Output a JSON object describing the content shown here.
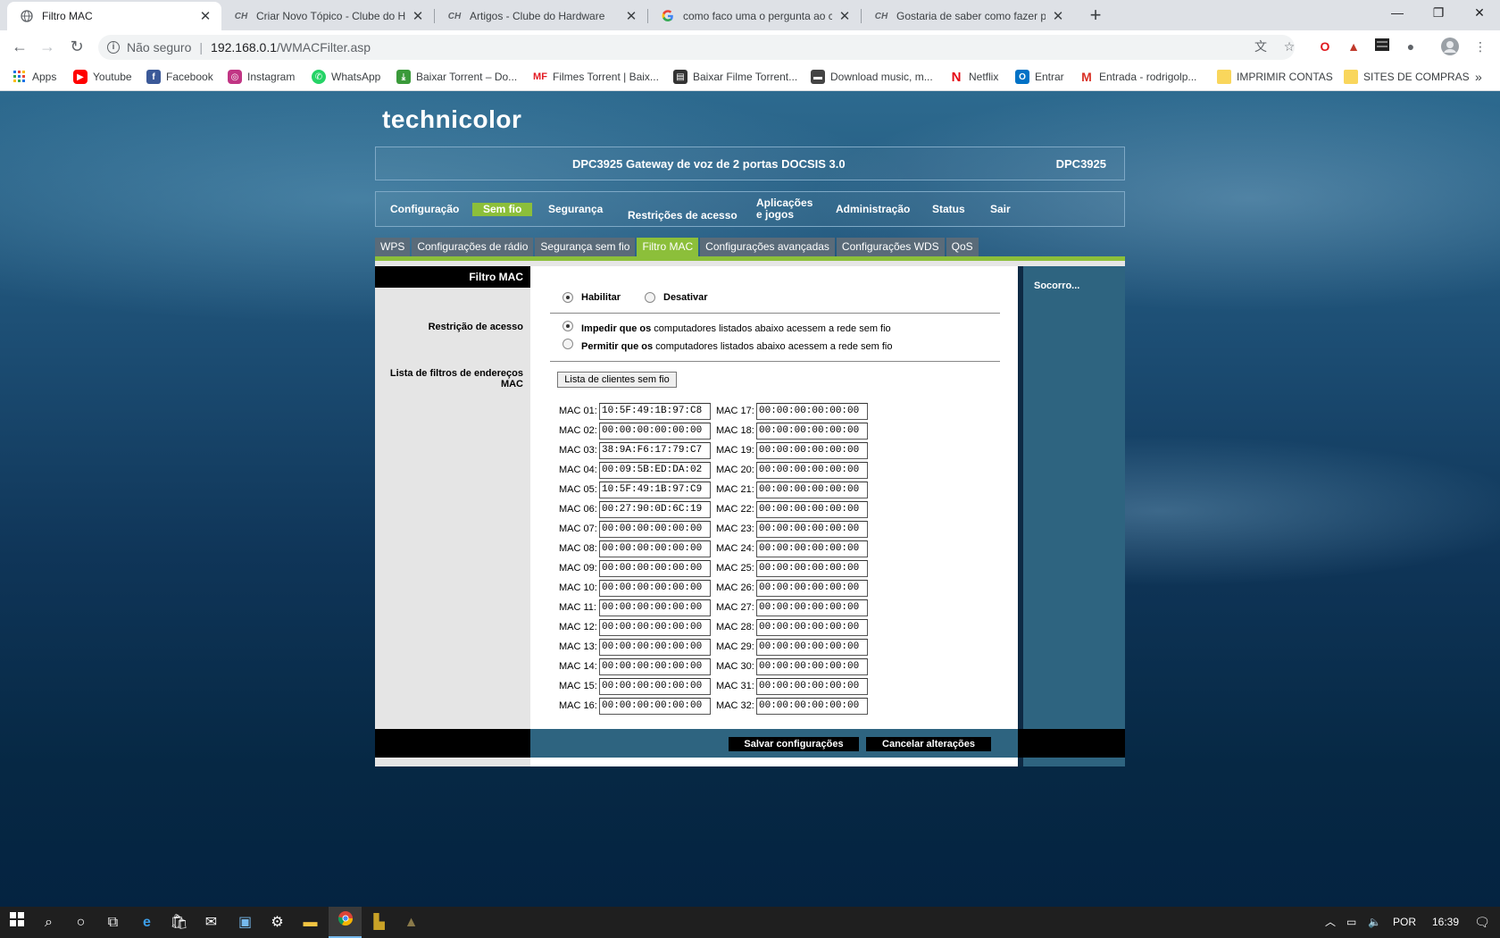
{
  "browser": {
    "tabs": [
      {
        "title": "Filtro MAC",
        "active": true
      },
      {
        "title": "Criar Novo Tópico - Clube do Hardware",
        "active": false
      },
      {
        "title": "Artigos - Clube do Hardware",
        "active": false
      },
      {
        "title": "como faco uma o pergunta ao clube",
        "active": false
      },
      {
        "title": "Gostaria de saber como fazer pedido",
        "active": false
      }
    ],
    "tab_close": "✕",
    "new_tab": "+",
    "window_controls": {
      "minimize": "—",
      "restore": "❐",
      "close": "✕"
    },
    "address": {
      "security": "Não seguro",
      "separator": "|",
      "host": "192.168.0.1",
      "path": "/WMACFilter.asp"
    },
    "bookmarks": [
      {
        "label": "Apps",
        "icon": "apps-grid-icon"
      },
      {
        "label": "Youtube",
        "icon": "youtube-icon"
      },
      {
        "label": "Facebook",
        "icon": "facebook-icon"
      },
      {
        "label": "Instagram",
        "icon": "instagram-icon"
      },
      {
        "label": "WhatsApp",
        "icon": "whatsapp-icon"
      },
      {
        "label": "Baixar Torrent – Do...",
        "icon": "torrent-icon"
      },
      {
        "label": "Filmes Torrent | Baix...",
        "icon": "mf-icon"
      },
      {
        "label": "Baixar Filme Torrent...",
        "icon": "film-icon"
      },
      {
        "label": "Download music, m...",
        "icon": "car-icon"
      },
      {
        "label": "Netflix",
        "icon": "netflix-icon"
      },
      {
        "label": "Entrar",
        "icon": "outlook-icon"
      },
      {
        "label": "Entrada - rodrigolp...",
        "icon": "gmail-icon"
      },
      {
        "label": "IMPRIMIR CONTAS",
        "icon": "folder-icon"
      },
      {
        "label": "SITES DE COMPRAS",
        "icon": "folder-icon"
      }
    ],
    "bookmarks_more": "»"
  },
  "router": {
    "logo": "technicolor",
    "product": "DPC3925 Gateway de voz de 2 portas DOCSIS 3.0",
    "model": "DPC3925",
    "main_nav": {
      "configuracao": "Configuração",
      "sem_fio": "Sem fio",
      "seguranca": "Segurança",
      "restricoes": "Restrições de acesso",
      "aplicacoes_1": "Aplicações",
      "aplicacoes_2": "e jogos",
      "administracao": "Administração",
      "status": "Status",
      "sair": "Sair"
    },
    "sub_nav": [
      "WPS",
      "Configurações de rádio",
      "Segurança sem fio",
      "Filtro MAC",
      "Configurações avançadas",
      "Configurações WDS",
      "QoS"
    ],
    "section_title": "Filtro MAC",
    "labels": {
      "restricao": "Restrição de acesso",
      "lista_1": "Lista de filtros de endereços",
      "lista_2": "MAC"
    },
    "help": "Socorro...",
    "enable": {
      "habilitar": "Habilitar",
      "desativar": "Desativar",
      "selected": "habilitar"
    },
    "restriction": {
      "impedir_bold": "Impedir que os",
      "impedir_rest": " computadores listados abaixo acessem a rede sem fio",
      "permitir_bold": "Permitir que os",
      "permitir_rest": " computadores listados abaixo acessem a rede sem fio",
      "selected": "impedir"
    },
    "wireless_list_button": "Lista de clientes sem fio",
    "mac_left": [
      {
        "label": "MAC 01:",
        "value": "10:5F:49:1B:97:C8"
      },
      {
        "label": "MAC 02:",
        "value": "00:00:00:00:00:00"
      },
      {
        "label": "MAC 03:",
        "value": "38:9A:F6:17:79:C7"
      },
      {
        "label": "MAC 04:",
        "value": "00:09:5B:ED:DA:02"
      },
      {
        "label": "MAC 05:",
        "value": "10:5F:49:1B:97:C9"
      },
      {
        "label": "MAC 06:",
        "value": "00:27:90:0D:6C:19"
      },
      {
        "label": "MAC 07:",
        "value": "00:00:00:00:00:00"
      },
      {
        "label": "MAC 08:",
        "value": "00:00:00:00:00:00"
      },
      {
        "label": "MAC 09:",
        "value": "00:00:00:00:00:00"
      },
      {
        "label": "MAC 10:",
        "value": "00:00:00:00:00:00"
      },
      {
        "label": "MAC 11:",
        "value": "00:00:00:00:00:00"
      },
      {
        "label": "MAC 12:",
        "value": "00:00:00:00:00:00"
      },
      {
        "label": "MAC 13:",
        "value": "00:00:00:00:00:00"
      },
      {
        "label": "MAC 14:",
        "value": "00:00:00:00:00:00"
      },
      {
        "label": "MAC 15:",
        "value": "00:00:00:00:00:00"
      },
      {
        "label": "MAC 16:",
        "value": "00:00:00:00:00:00"
      }
    ],
    "mac_right": [
      {
        "label": "MAC 17:",
        "value": "00:00:00:00:00:00"
      },
      {
        "label": "MAC 18:",
        "value": "00:00:00:00:00:00"
      },
      {
        "label": "MAC 19:",
        "value": "00:00:00:00:00:00"
      },
      {
        "label": "MAC 20:",
        "value": "00:00:00:00:00:00"
      },
      {
        "label": "MAC 21:",
        "value": "00:00:00:00:00:00"
      },
      {
        "label": "MAC 22:",
        "value": "00:00:00:00:00:00"
      },
      {
        "label": "MAC 23:",
        "value": "00:00:00:00:00:00"
      },
      {
        "label": "MAC 24:",
        "value": "00:00:00:00:00:00"
      },
      {
        "label": "MAC 25:",
        "value": "00:00:00:00:00:00"
      },
      {
        "label": "MAC 26:",
        "value": "00:00:00:00:00:00"
      },
      {
        "label": "MAC 27:",
        "value": "00:00:00:00:00:00"
      },
      {
        "label": "MAC 28:",
        "value": "00:00:00:00:00:00"
      },
      {
        "label": "MAC 29:",
        "value": "00:00:00:00:00:00"
      },
      {
        "label": "MAC 30:",
        "value": "00:00:00:00:00:00"
      },
      {
        "label": "MAC 31:",
        "value": "00:00:00:00:00:00"
      },
      {
        "label": "MAC 32:",
        "value": "00:00:00:00:00:00"
      }
    ],
    "save": "Salvar configurações",
    "cancel": "Cancelar alterações"
  },
  "taskbar": {
    "language": "POR",
    "time": "16:39"
  },
  "colors": {
    "accent_green": "#8cbf3a",
    "subtab_gray": "#5a6b79",
    "help_panel": "#2e6480"
  }
}
